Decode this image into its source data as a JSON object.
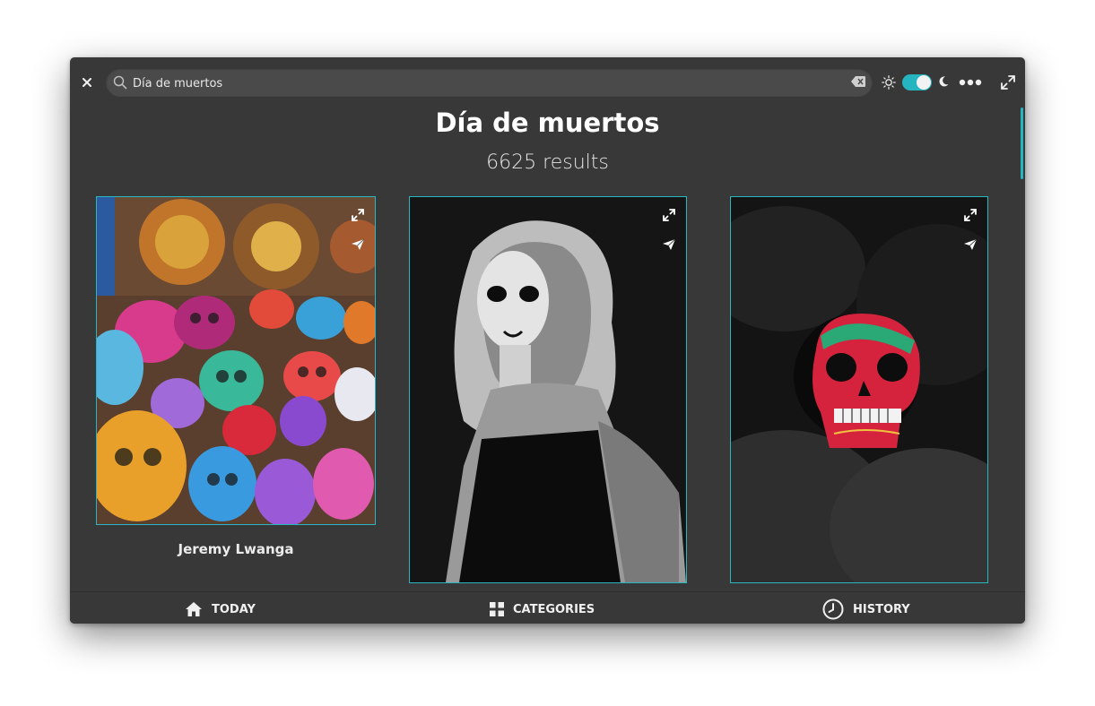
{
  "search": {
    "value": "Día de muertos"
  },
  "header": {
    "title": "Día de muertos",
    "results": "6625 results"
  },
  "cards": [
    {
      "author": "Jeremy Lwanga"
    },
    {
      "author": ""
    },
    {
      "author": ""
    }
  ],
  "nav": {
    "today": "TODAY",
    "categories": "CATEGORIES",
    "history": "HISTORY"
  },
  "theme": {
    "accent": "#27b7c1",
    "background": "#383838",
    "dark_mode": true
  },
  "icons": [
    "close-icon",
    "search-icon",
    "clear-icon",
    "sun-icon",
    "moon-icon",
    "more-icon",
    "fullscreen-icon",
    "expand-icon",
    "send-icon",
    "home-icon",
    "grid-icon",
    "clock-icon"
  ]
}
